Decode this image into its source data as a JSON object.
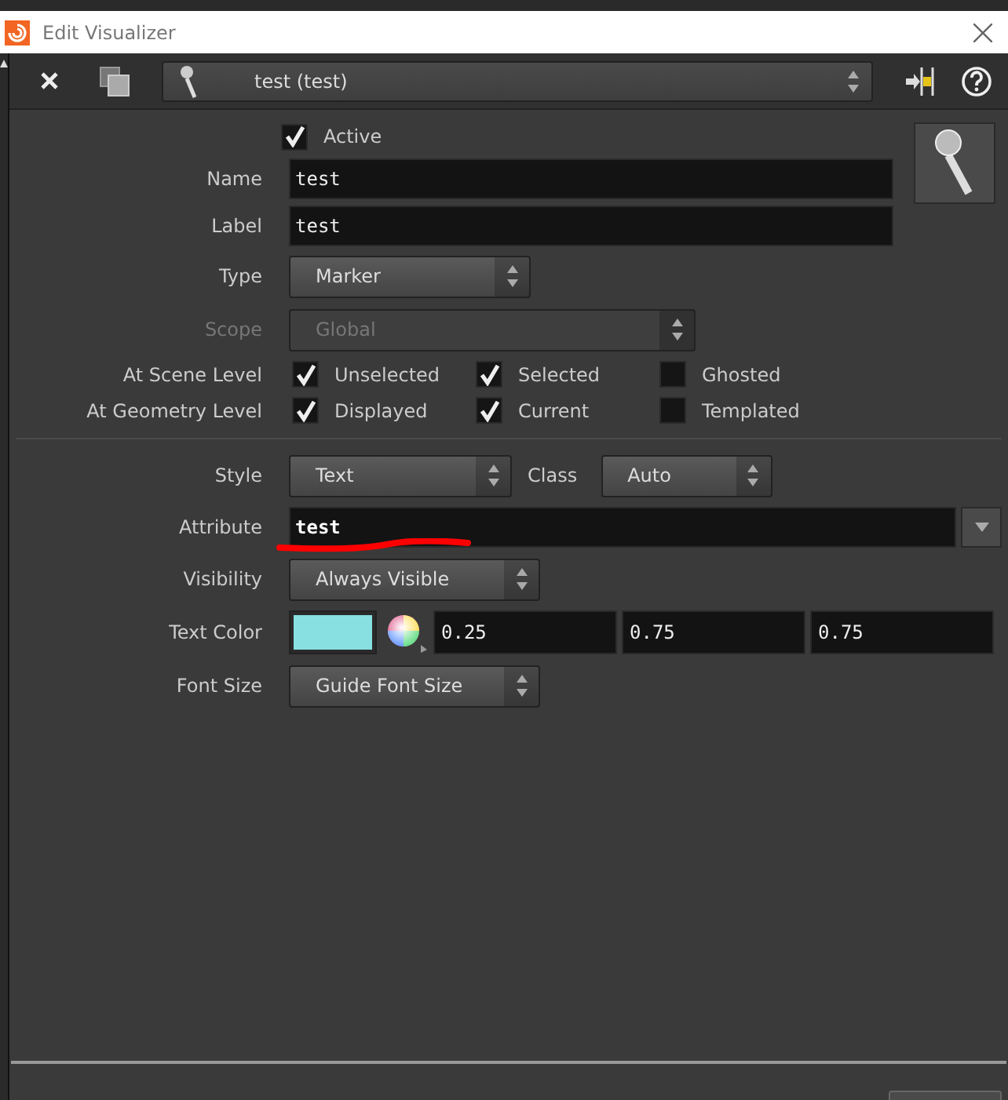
{
  "window": {
    "title": "Edit Visualizer"
  },
  "toolbar": {
    "selector": "test (test)"
  },
  "rows": [
    {
      "kind": "check",
      "label": "Active",
      "checked": true
    },
    {
      "kind": "text",
      "label": "Name",
      "value": "test"
    },
    {
      "kind": "text",
      "label": "Label",
      "value": "test"
    },
    {
      "kind": "dropdown",
      "label": "Type",
      "value": "Marker",
      "disabled": false
    },
    {
      "kind": "dropdown",
      "label": "Scope",
      "value": "Global",
      "disabled": true
    },
    {
      "kind": "checks",
      "label": "At Scene Level",
      "options": [
        {
          "label": "Unselected",
          "checked": true
        },
        {
          "label": "Selected",
          "checked": true
        },
        {
          "label": "Ghosted",
          "checked": false
        }
      ]
    },
    {
      "kind": "checks",
      "label": "At Geometry Level",
      "options": [
        {
          "label": "Displayed",
          "checked": true
        },
        {
          "label": "Current",
          "checked": true
        },
        {
          "label": "Templated",
          "checked": false
        }
      ]
    },
    {
      "kind": "divider"
    },
    {
      "kind": "pair",
      "label": "Style",
      "value": "Text",
      "label2": "Class",
      "value2": "Auto"
    },
    {
      "kind": "attribute",
      "label": "Attribute",
      "value": "test"
    },
    {
      "kind": "dropdown",
      "label": "Visibility",
      "value": "Always Visible",
      "disabled": false
    },
    {
      "kind": "color",
      "label": "Text Color",
      "values": [
        "0.25",
        "0.75",
        "0.75"
      ]
    },
    {
      "kind": "dropdown",
      "label": "Font Size",
      "value": "Guide Font Size",
      "disabled": false
    }
  ]
}
